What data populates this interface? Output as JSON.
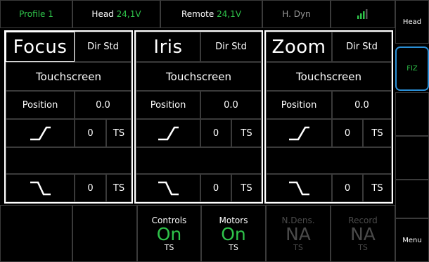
{
  "status_bar": {
    "profile": "Profile 1",
    "head_label": "Head",
    "head_value": "24,1V",
    "remote_label": "Remote",
    "remote_value": "24,1V",
    "mode": "H. Dyn",
    "signal_icon": "signal-bars-icon"
  },
  "sidebar": {
    "items": [
      "Head",
      "FIZ",
      "",
      "",
      "",
      "Menu"
    ],
    "active": "FIZ"
  },
  "axes": [
    {
      "name": "Focus",
      "dir": "Dir Std",
      "source": "Touchscreen",
      "position_label": "Position",
      "position": "0.0",
      "upper_value": "0",
      "upper_src": "TS",
      "lower_value": "0",
      "lower_src": "TS"
    },
    {
      "name": "Iris",
      "dir": "Dir Std",
      "source": "Touchscreen",
      "position_label": "Position",
      "position": "0.0",
      "upper_value": "0",
      "upper_src": "TS",
      "lower_value": "0",
      "lower_src": "TS"
    },
    {
      "name": "Zoom",
      "dir": "Dir Std",
      "source": "Touchscreen",
      "position_label": "Position",
      "position": "0.0",
      "upper_value": "0",
      "upper_src": "TS",
      "lower_value": "0",
      "lower_src": "TS"
    }
  ],
  "status_tiles": [
    {
      "title": "Controls",
      "value": "On",
      "sub": "TS",
      "enabled": true
    },
    {
      "title": "Motors",
      "value": "On",
      "sub": "TS",
      "enabled": true
    },
    {
      "title": "N.Dens.",
      "value": "NA",
      "sub": "TS",
      "enabled": false
    },
    {
      "title": "Record",
      "value": "NA",
      "sub": "TS",
      "enabled": false
    }
  ],
  "colors": {
    "accent_green": "#2fc44a",
    "active_border": "#2a8fd6",
    "disabled": "#4a4a4a"
  }
}
